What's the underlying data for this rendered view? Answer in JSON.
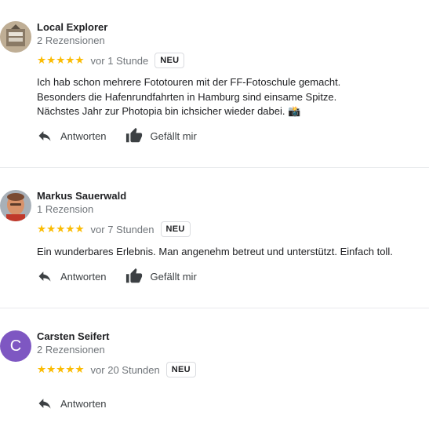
{
  "reviews": [
    {
      "name": "Local Explorer",
      "count": "2 Rezensionen",
      "stars": 5,
      "time": "vor 1 Stunde",
      "badge": "NEU",
      "lines": [
        "Ich hab schon mehrere Fototouren mit der FF-Fotoschule gemacht.",
        "Besonders die Hafenrundfahrten in Hamburg sind einsame Spitze.",
        "Nächstes Jahr zur Photopia bin ichsicher wieder dabei."
      ],
      "emoji": "📸",
      "reply_label": "Antworten",
      "like_label": "Gefällt mir"
    },
    {
      "name": "Markus Sauerwald",
      "count": "1 Rezension",
      "stars": 5,
      "time": "vor 7 Stunden",
      "badge": "NEU",
      "lines": [
        "Ein wunderbares Erlebnis. Man angenehm betreut und unterstützt. Einfach toll."
      ],
      "reply_label": "Antworten",
      "like_label": "Gefällt mir"
    },
    {
      "name": "Carsten Seifert",
      "count": "2 Rezensionen",
      "stars": 5,
      "time": "vor 20 Stunden",
      "badge": "NEU",
      "avatar_letter": "C",
      "avatar_color": "#7e57c2",
      "reply_label": "Antworten"
    }
  ],
  "colors": {
    "star": "#fbbc04",
    "divider": "#e8eaed"
  }
}
